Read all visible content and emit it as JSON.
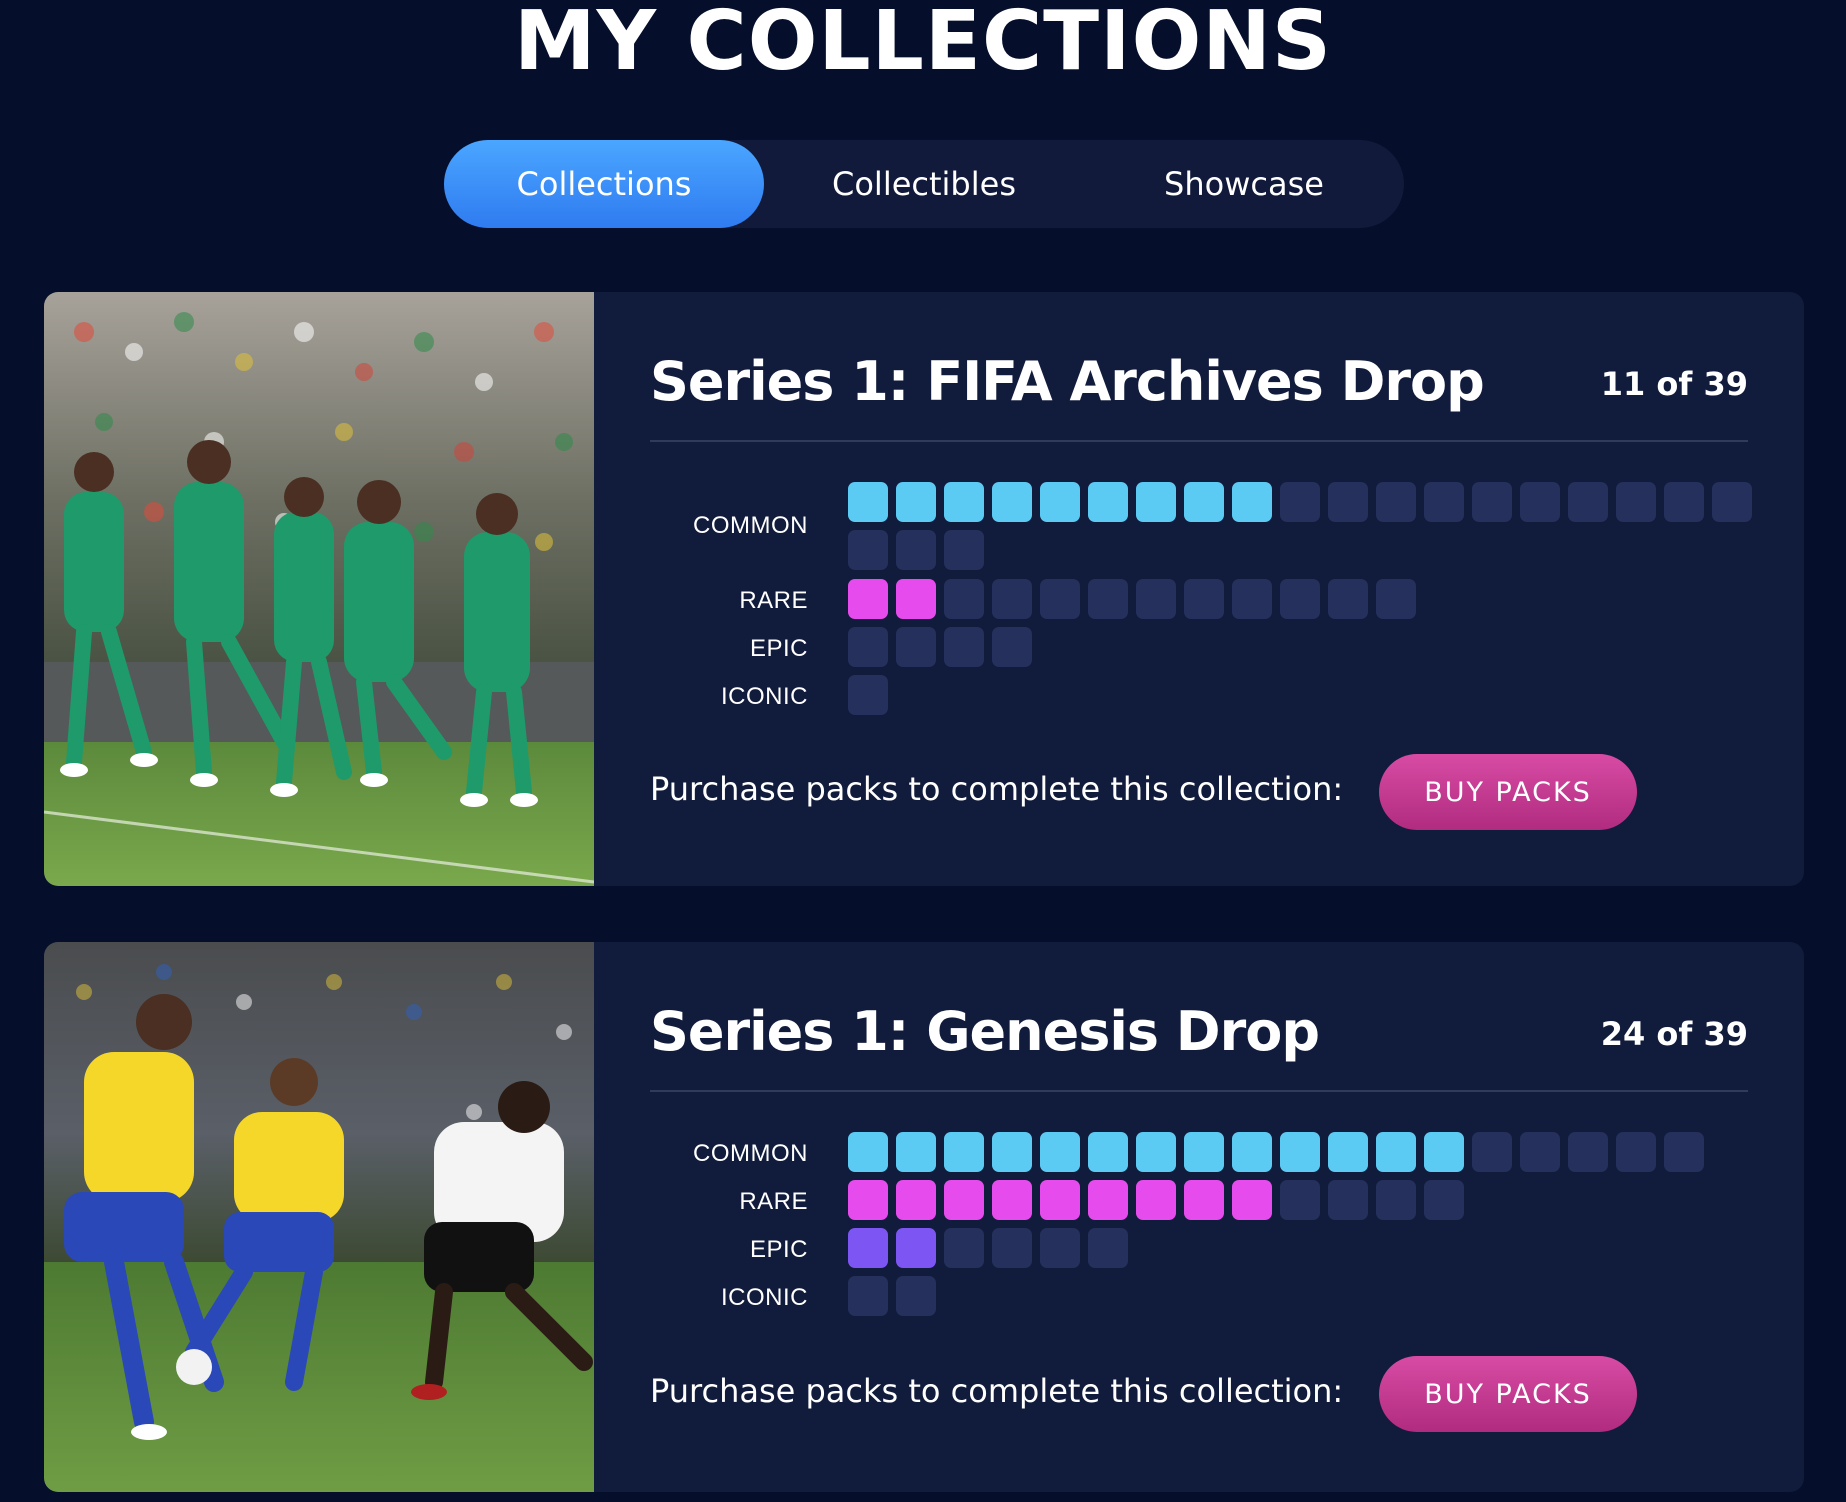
{
  "page": {
    "title": "MY COLLECTIONS"
  },
  "tabs": [
    {
      "label": "Collections",
      "active": true
    },
    {
      "label": "Collectibles",
      "active": false
    },
    {
      "label": "Showcase",
      "active": false
    }
  ],
  "colors": {
    "common_owned": "#5ccbf3",
    "rare_owned": "#e64ced",
    "epic_owned": "#7c55f2",
    "iconic_owned": "#f2c14e",
    "slot_empty": "#25305c",
    "active_tab": "#3b8ff8",
    "buy_button": "#c13a92"
  },
  "collections": [
    {
      "title": "Series 1: FIFA Archives Drop",
      "count_text": "11 of 39",
      "image": "soccer-celebration-photo",
      "rarities": [
        {
          "label": "COMMON",
          "owned": 9,
          "total": 22
        },
        {
          "label": "RARE",
          "owned": 2,
          "total": 12
        },
        {
          "label": "EPIC",
          "owned": 0,
          "total": 4
        },
        {
          "label": "ICONIC",
          "owned": 0,
          "total": 1
        }
      ],
      "purchase_text": "Purchase packs to complete this collection:",
      "button_label": "BUY PACKS"
    },
    {
      "title": "Series 1: Genesis Drop",
      "count_text": "24 of 39",
      "image": "soccer-match-photo",
      "rarities": [
        {
          "label": "COMMON",
          "owned": 13,
          "total": 18
        },
        {
          "label": "RARE",
          "owned": 9,
          "total": 13
        },
        {
          "label": "EPIC",
          "owned": 2,
          "total": 6
        },
        {
          "label": "ICONIC",
          "owned": 0,
          "total": 2
        }
      ],
      "purchase_text": "Purchase packs to complete this collection:",
      "button_label": "BUY PACKS"
    }
  ]
}
